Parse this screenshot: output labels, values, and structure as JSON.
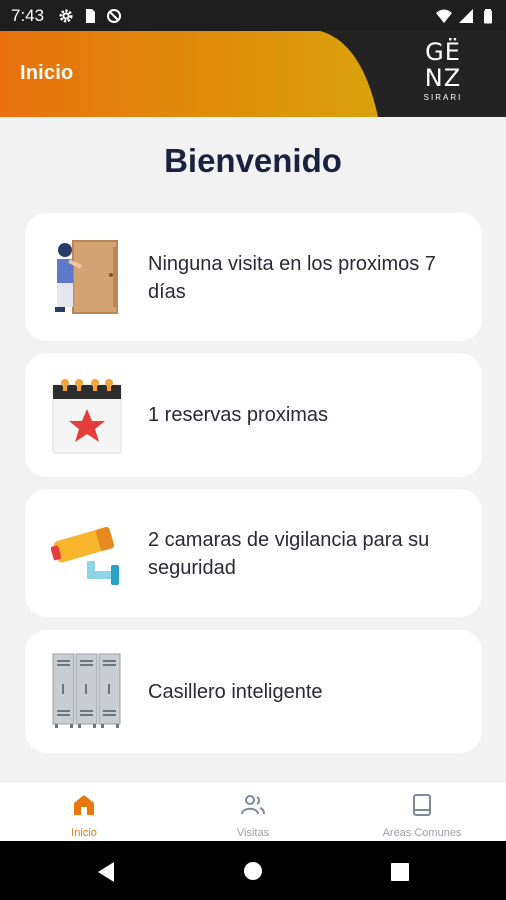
{
  "status_bar": {
    "time": "7:43",
    "left_icons": [
      "gear-icon",
      "sim-card-icon",
      "dnd-icon"
    ],
    "right_icons": [
      "wifi-icon",
      "signal-icon",
      "battery-icon"
    ]
  },
  "header": {
    "title": "Inicio",
    "logo": {
      "line1": "GË",
      "line2": "NZ",
      "sub": "SIRARI"
    },
    "colors": {
      "gradient_start": "#e8710e",
      "gradient_end": "#d9a20b",
      "background": "#232323"
    }
  },
  "main": {
    "welcome": "Bienvenido",
    "cards": [
      {
        "icon": "visitor-door-icon",
        "text": "Ninguna visita en los proximos 7 días"
      },
      {
        "icon": "calendar-star-icon",
        "text": "1 reservas proximas"
      },
      {
        "icon": "security-camera-icon",
        "text": "2 camaras de vigilancia para su seguridad"
      },
      {
        "icon": "lockers-icon",
        "text": "Casillero inteligente"
      }
    ]
  },
  "bottom_nav": {
    "items": [
      {
        "label": "Inicio",
        "icon": "home-icon",
        "active": true
      },
      {
        "label": "Visitas",
        "icon": "people-icon",
        "active": false
      },
      {
        "label": "Areas Comunes",
        "icon": "book-icon",
        "active": false
      }
    ],
    "active_color": "#e8780c"
  },
  "system_nav": {
    "buttons": [
      "back-icon",
      "home-circle-icon",
      "recents-icon"
    ]
  }
}
